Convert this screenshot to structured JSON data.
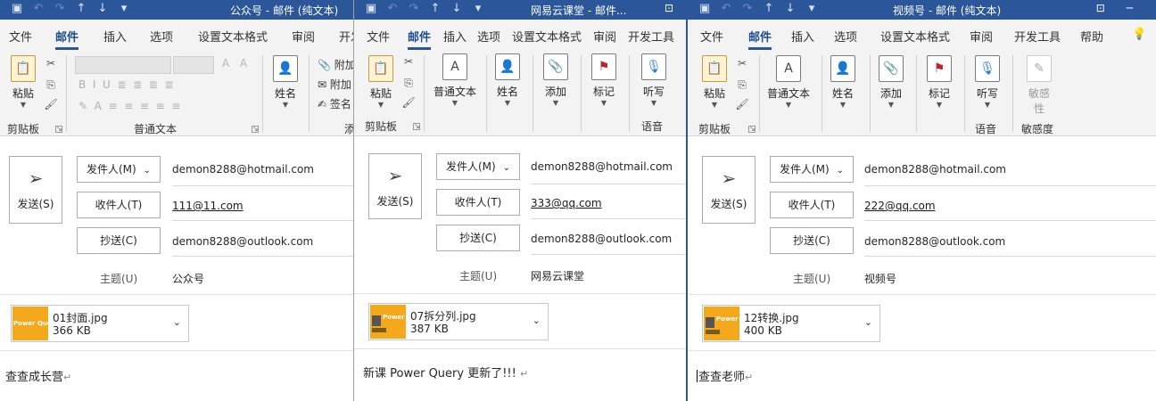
{
  "windows": [
    {
      "title": "公众号 - 邮件 (纯文本)",
      "tabs": [
        "文件",
        "邮件",
        "插入",
        "选项",
        "设置文本格式",
        "审阅",
        "开发"
      ],
      "ribbon": {
        "paste_label": "粘贴",
        "name_label": "姓名",
        "attach_partial": "附加",
        "attach_partial2": "附加",
        "signature_partial": "签名",
        "group_clipboard": "剪贴板",
        "group_basic_text": "普通文本",
        "group_partial": "添"
      },
      "send_label": "发送(S)",
      "from_button": "发件人(M)",
      "from_value": "demon8288@hotmail.com",
      "to_button": "收件人(T)",
      "to_value": "111@11.com",
      "cc_button": "抄送(C)",
      "cc_value": "demon8288@outlook.com",
      "subject_label": "主题(U)",
      "subject_value": "公众号",
      "attachment": {
        "name": "01封面.jpg",
        "size": "366 KB",
        "thumb_text": "Power Query"
      },
      "body": "查查成长营",
      "para_mark": "↵"
    },
    {
      "title": "网易云课堂 - 邮件...",
      "tabs": [
        "文件",
        "邮件",
        "插入",
        "选项",
        "设置文本格式",
        "审阅",
        "开发工具"
      ],
      "ribbon": {
        "paste_label": "粘贴",
        "basic_text_label": "普通文本",
        "name_label": "姓名",
        "add_label": "添加",
        "flag_label": "标记",
        "dictate_label": "听写",
        "group_clipboard": "剪贴板",
        "group_voice": "语音"
      },
      "send_label": "发送(S)",
      "from_button": "发件人(M)",
      "from_value": "demon8288@hotmail.com",
      "to_button": "收件人(T)",
      "to_value": "333@qq.com",
      "cc_button": "抄送(C)",
      "cc_value": "demon8288@outlook.com",
      "subject_label": "主题(U)",
      "subject_value": "网易云课堂",
      "attachment": {
        "name": "07拆分列.jpg",
        "size": "387 KB",
        "thumb_text": "Power"
      },
      "body": "新课 Power Query 更新了!!!",
      "para_mark": "↵"
    },
    {
      "title": "视频号 - 邮件 (纯文本)",
      "tabs": [
        "文件",
        "邮件",
        "插入",
        "选项",
        "设置文本格式",
        "审阅",
        "开发工具",
        "帮助"
      ],
      "ribbon": {
        "paste_label": "粘贴",
        "basic_text_label": "普通文本",
        "name_label": "姓名",
        "add_label": "添加",
        "flag_label": "标记",
        "dictate_label": "听写",
        "sensitivity_label": "敏感",
        "sensitivity_label2": "性",
        "group_clipboard": "剪贴板",
        "group_voice": "语音",
        "group_sensitivity": "敏感度"
      },
      "send_label": "发送(S)",
      "from_button": "发件人(M)",
      "from_value": "demon8288@hotmail.com",
      "to_button": "收件人(T)",
      "to_value": "222@qq.com",
      "cc_button": "抄送(C)",
      "cc_value": "demon8288@outlook.com",
      "subject_label": "主题(U)",
      "subject_value": "视频号",
      "attachment": {
        "name": "12转换.jpg",
        "size": "400 KB",
        "thumb_text": "Power"
      },
      "body": "查查老师",
      "para_mark": "↵"
    }
  ],
  "colors": {
    "titlebar": "#2b579a",
    "ribbon": "#f3f3f3",
    "thumb": "#f4a81c"
  }
}
